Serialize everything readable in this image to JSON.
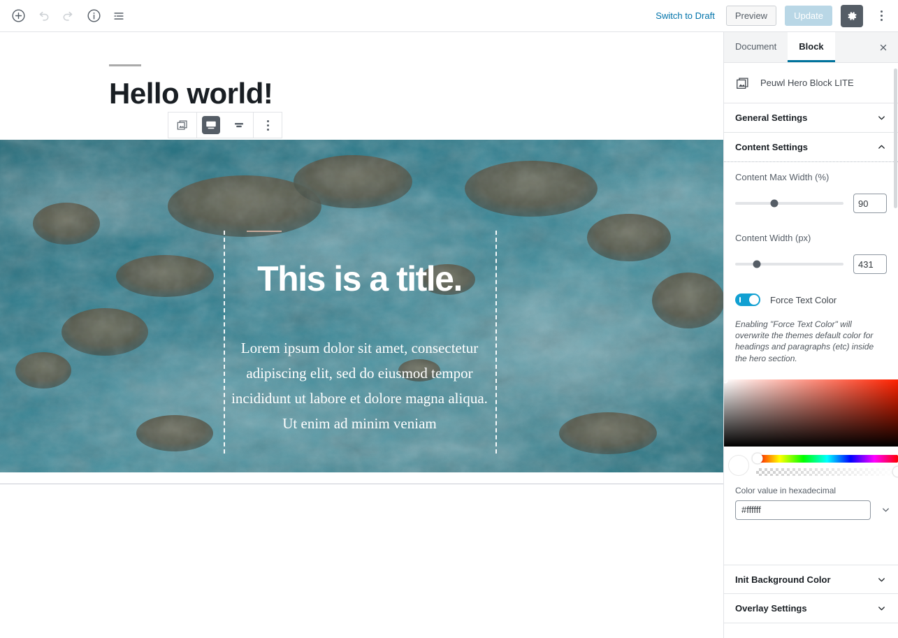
{
  "topbar": {
    "add_block_label": "Add block",
    "undo_label": "Undo",
    "redo_label": "Redo",
    "info_label": "Content structure",
    "block_nav_label": "Block navigation",
    "switch_to_draft": "Switch to Draft",
    "preview": "Preview",
    "update": "Update",
    "settings_label": "Settings",
    "more_label": "More tools & options"
  },
  "canvas": {
    "post_title": "Hello world!",
    "block_toolbar": {
      "block_type_label": "Peuwl Hero Block LITE",
      "wide_width_label": "Wide width",
      "full_width_label": "Full width",
      "more_options_label": "More options"
    },
    "hero": {
      "title": "This is a title.",
      "paragraph": "Lorem ipsum dolor sit amet, consectetur adipiscing elit, sed do eiusmod tempor incididunt ut labore et dolore magna aliqua. Ut enim ad minim veniam",
      "image_alt": "aerial-ocean-reef-photo",
      "text_color": "#ffffff",
      "guide_color": "#ffffff",
      "divider_color": "#c7a99a"
    }
  },
  "sidebar": {
    "tabs": [
      {
        "label": "Document",
        "active": false
      },
      {
        "label": "Block",
        "active": true
      }
    ],
    "close_label": "Close settings",
    "block_card": {
      "icon": "image-stack-icon",
      "name": "Peuwl Hero Block LITE"
    },
    "panels": [
      {
        "label": "General Settings",
        "expanded": false
      },
      {
        "label": "Content Settings",
        "expanded": true
      },
      {
        "label": "Init Background Color",
        "expanded": false
      },
      {
        "label": "Overlay Settings",
        "expanded": false
      }
    ],
    "content_settings": {
      "max_width": {
        "label": "Content Max Width (%)",
        "value": "90",
        "slider_percent": 36
      },
      "content_width": {
        "label": "Content Width (px)",
        "value": "431",
        "slider_percent": 20
      },
      "force_text_color": {
        "label": "Force Text Color",
        "enabled": true,
        "accent": "#11a0d2"
      },
      "help_text": "Enabling \"Force Text Color\" will overwrite the themes default color for headings and paragraphs (etc) inside the hero section.",
      "color_picker": {
        "hex_label": "Color value in hexadecimal",
        "hex_value": "#ffffff",
        "hue_percent": 1,
        "alpha_percent": 100,
        "swatch": "#ffffff"
      }
    }
  }
}
